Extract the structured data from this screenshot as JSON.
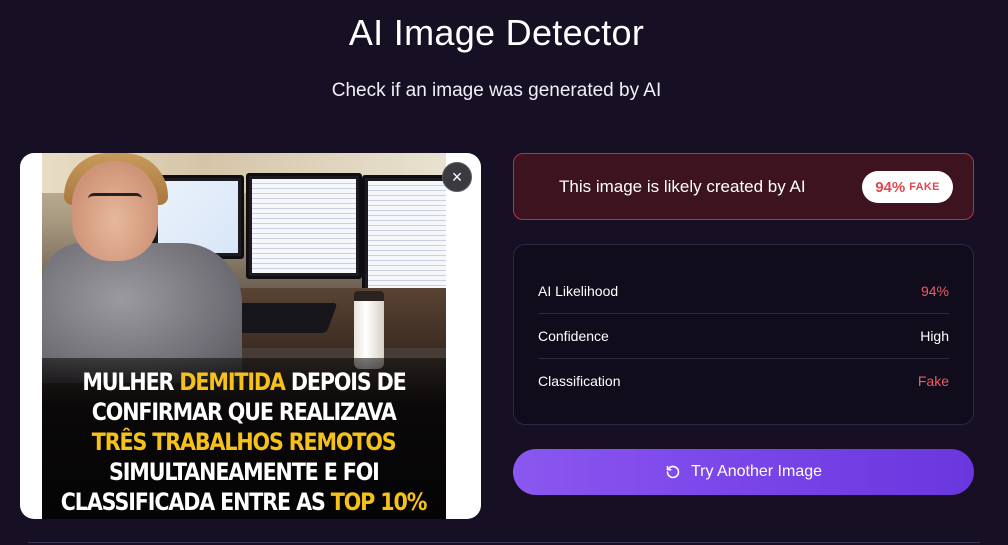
{
  "header": {
    "title": "AI Image Detector",
    "subtitle": "Check if an image was generated by AI"
  },
  "uploaded_image": {
    "caption_lines": [
      [
        {
          "text": "MULHER ",
          "hl": false
        },
        {
          "text": "DEMITIDA",
          "hl": true
        },
        {
          "text": " DEPOIS DE",
          "hl": false
        }
      ],
      [
        {
          "text": "CONFIRMAR QUE REALIZAVA",
          "hl": false
        }
      ],
      [
        {
          "text": "TRÊS TRABALHOS REMOTOS",
          "hl": true
        }
      ],
      [
        {
          "text": "SIMULTANEAMENTE E FOI",
          "hl": false
        }
      ],
      [
        {
          "text": "CLASSIFICADA ENTRE AS ",
          "hl": false
        },
        {
          "text": "TOP 10%",
          "hl": true
        }
      ]
    ],
    "close_label": "×",
    "close_icon": "close-icon"
  },
  "result": {
    "text": "This image is likely created by AI",
    "badge_percent": "94%",
    "badge_label": "FAKE"
  },
  "stats": [
    {
      "label": "AI Likelihood",
      "value": "94%",
      "color": "#ee5a64"
    },
    {
      "label": "Confidence",
      "value": "High",
      "color": "#ffffff"
    },
    {
      "label": "Classification",
      "value": "Fake",
      "color": "#ee5a64"
    }
  ],
  "actions": {
    "try_another_label": "Try Another Image",
    "try_another_icon": "refresh-icon"
  },
  "colors": {
    "background": "#170f24",
    "accent_purple": "#7a45e8",
    "alert_red": "#e04852",
    "caption_highlight": "#f6c21a"
  }
}
